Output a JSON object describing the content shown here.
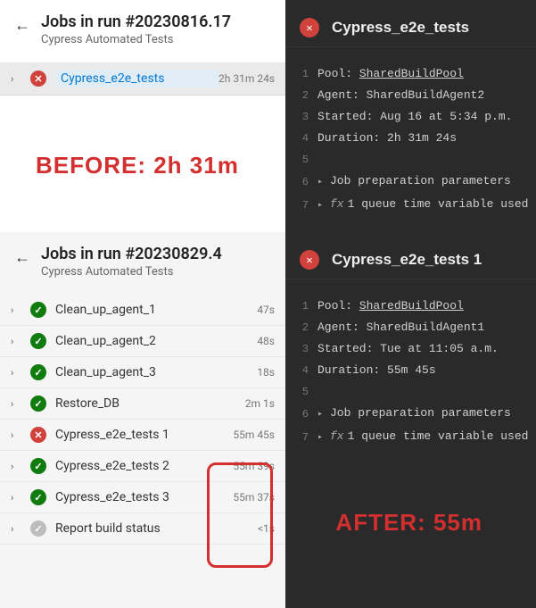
{
  "top": {
    "header": {
      "title": "Jobs in run #20230816.17",
      "sub": "Cypress Automated Tests"
    },
    "jobs": [
      {
        "name": "Cypress_e2e_tests",
        "time": "2h 31m 24s",
        "status": "fail",
        "link": true
      }
    ],
    "annotation": "BEFORE: 2h 31m",
    "log": {
      "title": "Cypress_e2e_tests",
      "lines": [
        {
          "n": 1,
          "kind": "kv",
          "k": "Pool: ",
          "v": "SharedBuildPool",
          "u": true
        },
        {
          "n": 2,
          "kind": "kv",
          "k": "Agent: ",
          "v": "SharedBuildAgent2"
        },
        {
          "n": 3,
          "kind": "kv",
          "k": "Started: ",
          "v": "Aug 16 at 5:34 p.m."
        },
        {
          "n": 4,
          "kind": "kv",
          "k": "Duration: ",
          "v": "2h 31m 24s"
        },
        {
          "n": 5,
          "kind": "blank"
        },
        {
          "n": 6,
          "kind": "fold",
          "t": "Job preparation parameters"
        },
        {
          "n": 7,
          "kind": "fx",
          "t": "1 queue time variable used"
        }
      ]
    }
  },
  "bottom": {
    "header": {
      "title": "Jobs in run #20230829.4",
      "sub": "Cypress Automated Tests"
    },
    "jobs": [
      {
        "name": "Clean_up_agent_1",
        "time": "47s",
        "status": "pass"
      },
      {
        "name": "Clean_up_agent_2",
        "time": "48s",
        "status": "pass"
      },
      {
        "name": "Clean_up_agent_3",
        "time": "18s",
        "status": "pass"
      },
      {
        "name": "Restore_DB",
        "time": "2m 1s",
        "status": "pass"
      },
      {
        "name": "Cypress_e2e_tests 1",
        "time": "55m 45s",
        "status": "fail"
      },
      {
        "name": "Cypress_e2e_tests 2",
        "time": "55m 39s",
        "status": "pass"
      },
      {
        "name": "Cypress_e2e_tests 3",
        "time": "55m 37s",
        "status": "pass"
      },
      {
        "name": "Report build status",
        "time": "<1s",
        "status": "neutral"
      }
    ],
    "annotation": "AFTER: 55m",
    "log": {
      "title": "Cypress_e2e_tests 1",
      "lines": [
        {
          "n": 1,
          "kind": "kv",
          "k": "Pool: ",
          "v": "SharedBuildPool",
          "u": true
        },
        {
          "n": 2,
          "kind": "kv",
          "k": "Agent: ",
          "v": "SharedBuildAgent1"
        },
        {
          "n": 3,
          "kind": "kv",
          "k": "Started: ",
          "v": "Tue at 11:05 a.m."
        },
        {
          "n": 4,
          "kind": "kv",
          "k": "Duration: ",
          "v": "55m 45s"
        },
        {
          "n": 5,
          "kind": "blank"
        },
        {
          "n": 6,
          "kind": "fold",
          "t": "Job preparation parameters"
        },
        {
          "n": 7,
          "kind": "fx",
          "t": "1 queue time variable used"
        }
      ]
    }
  }
}
